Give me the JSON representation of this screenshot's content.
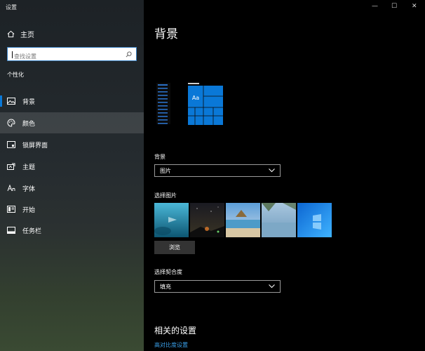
{
  "window": {
    "title": "设置",
    "controls": {
      "minimize": "—",
      "maximize": "☐",
      "close": "✕"
    }
  },
  "sidebar": {
    "home_label": "主页",
    "search_placeholder": "查找设置",
    "section_title": "个性化",
    "items": [
      {
        "label": "背景",
        "icon": "picture-icon"
      },
      {
        "label": "颜色",
        "icon": "palette-icon"
      },
      {
        "label": "锁屏界面",
        "icon": "lock-screen-icon"
      },
      {
        "label": "主题",
        "icon": "theme-icon"
      },
      {
        "label": "字体",
        "icon": "font-icon"
      },
      {
        "label": "开始",
        "icon": "start-icon"
      },
      {
        "label": "任务栏",
        "icon": "taskbar-icon"
      }
    ]
  },
  "main": {
    "title": "背景",
    "preview_text": "Aa",
    "background_label": "背景",
    "background_value": "图片",
    "choose_picture_label": "选择图片",
    "browse_label": "浏览",
    "fit_label": "选择契合度",
    "fit_value": "填充",
    "related_title": "相关的设置",
    "related_link": "高对比度设置"
  },
  "colors": {
    "accent": "#0a78d7",
    "link": "#3a9fe8"
  }
}
